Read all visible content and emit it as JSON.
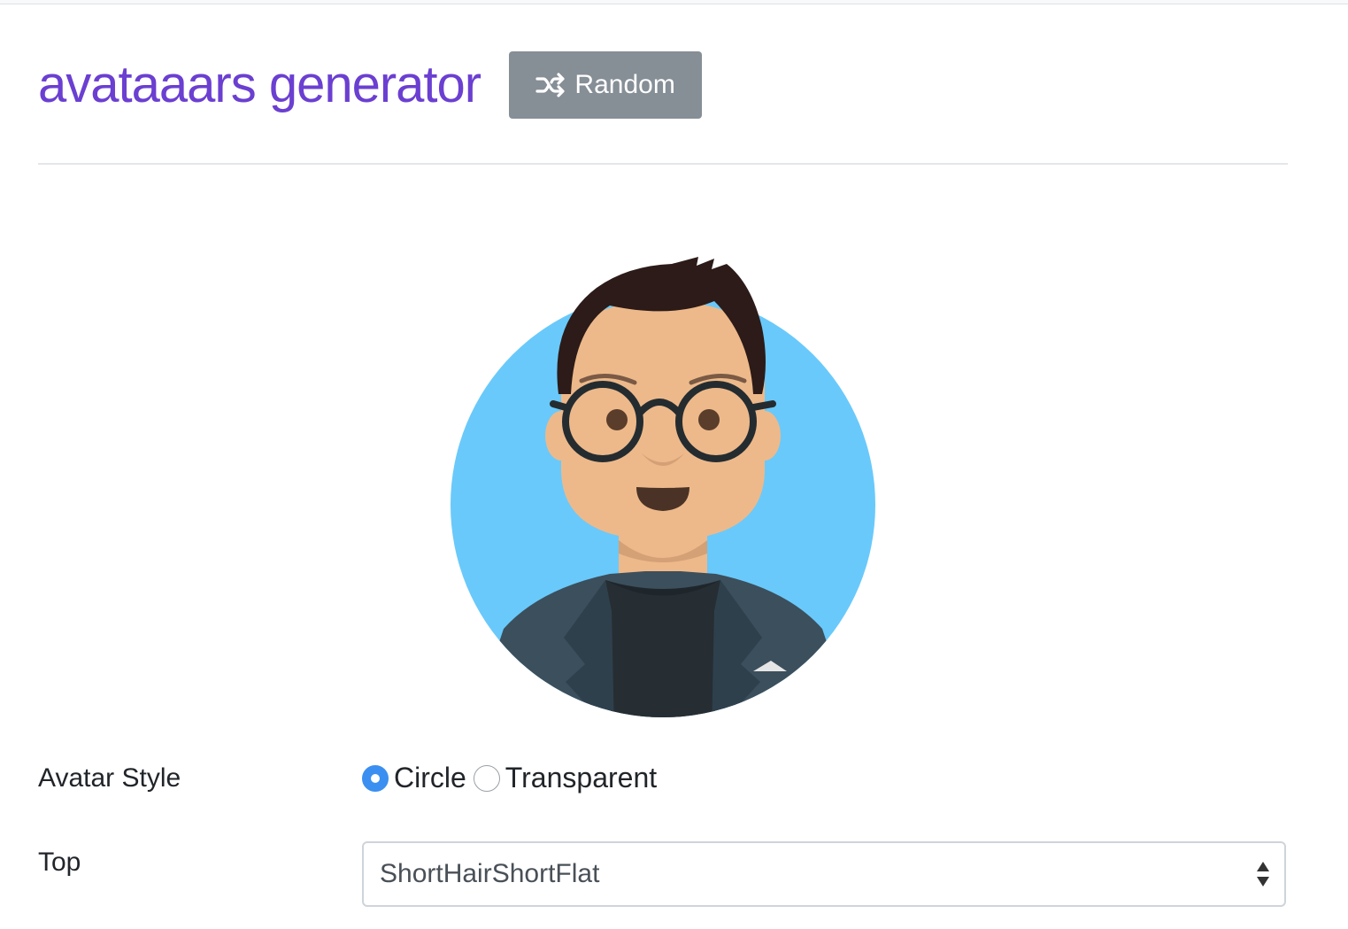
{
  "header": {
    "title": "avataaars generator",
    "random_label": "Random",
    "random_icon": "shuffle-icon"
  },
  "colors": {
    "title": "#6b3fd1",
    "random_button": "#868e96",
    "avatar_background": "#69c9fb",
    "skin": "#edb98a",
    "hair": "#2c1b18",
    "jacket": "#3c4f5c",
    "shirt": "#262e33",
    "radio_checked": "#3b8ff0"
  },
  "avatar": {
    "style": "Circle",
    "top": "ShortHairShortFlat",
    "accessories": "Round",
    "clothes": "BlazerShirt"
  },
  "form": {
    "avatar_style": {
      "label": "Avatar Style",
      "options": [
        "Circle",
        "Transparent"
      ],
      "selected": "Circle"
    },
    "top": {
      "label": "Top",
      "value": "ShortHairShortFlat"
    }
  }
}
